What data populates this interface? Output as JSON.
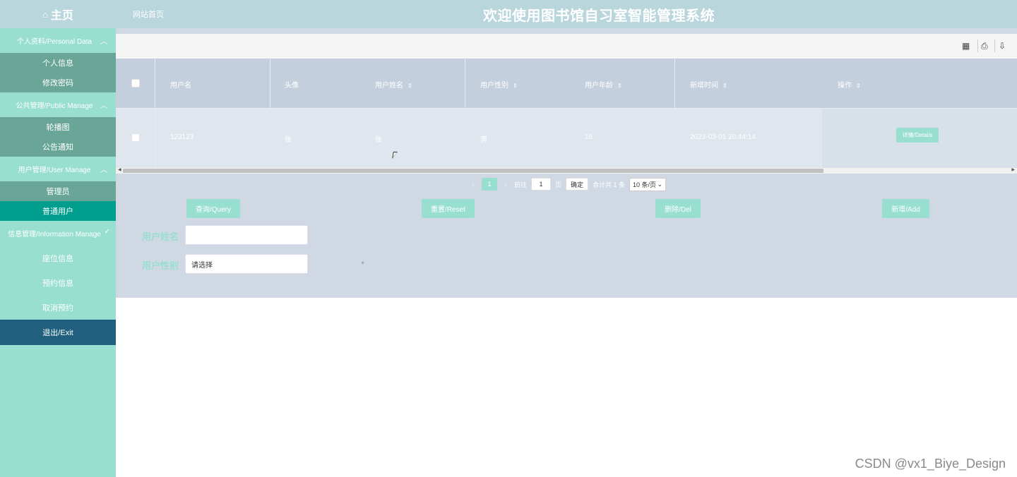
{
  "header": {
    "home_label": "主页",
    "home_icon": "home-icon",
    "site_link": "网站首页",
    "title": "欢迎使用图书馆自习室智能管理系统"
  },
  "sidebar": {
    "groups": [
      {
        "title": "个人资料/Personal Data",
        "items": [
          "个人信息",
          "修改密码"
        ]
      },
      {
        "title": "公共管理/Public Manage",
        "items": [
          "轮播图",
          "公告通知"
        ]
      },
      {
        "title": "用户管理/User Manage",
        "items": [
          "管理员",
          "普通用户"
        ]
      },
      {
        "title": "信息管理/Information Manage",
        "items": [
          "座位信息",
          "预约信息",
          "取消预约"
        ]
      }
    ],
    "active_item": "普通用户",
    "exit": "退出/Exit"
  },
  "toolbar": {
    "icons": [
      "grid-icon",
      "print-icon",
      "export-icon"
    ]
  },
  "table": {
    "columns": [
      "用户名",
      "头像",
      "用户姓名",
      "用户性别",
      "用户年龄",
      "新增时间",
      "操作"
    ],
    "rows": [
      {
        "username": "123123",
        "avatar": "张",
        "name": "张",
        "gender": "男",
        "age": "16",
        "created": "2023-03-01 20:44:14",
        "action": "详情/Details"
      }
    ]
  },
  "pager": {
    "prev": "‹",
    "page": "1",
    "next": "›",
    "goto_label": "前往",
    "goto_value": "1",
    "page_unit": "页",
    "confirm": "确定",
    "total": "合计共 1 条",
    "page_size": "10 条/页"
  },
  "actions": {
    "query": "查询/Query",
    "reset": "重置/Reset",
    "delete": "删除/Del",
    "add": "新增/Add"
  },
  "search": {
    "name_label": "用户姓名",
    "name_value": "",
    "gender_label": "用户性别",
    "gender_placeholder": "请选择"
  },
  "watermark": "CSDN @vx1_Biye_Design",
  "colors": {
    "accent": "#98dfcf",
    "active": "#009e8c",
    "submenu": "#6aa698",
    "exit": "#20607e",
    "header": "#b9d6dd"
  }
}
